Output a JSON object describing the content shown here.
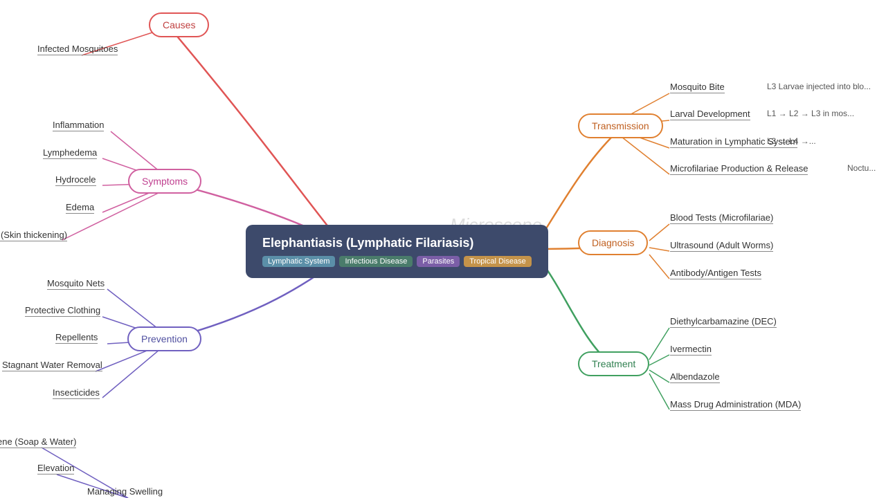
{
  "center": {
    "title": "Elephantiasis (Lymphatic Filariasis)",
    "tags": [
      {
        "label": "Lymphatic System",
        "class": "tag-lymphatic"
      },
      {
        "label": "Infectious Disease",
        "class": "tag-infectious"
      },
      {
        "label": "Parasites",
        "class": "tag-parasites"
      },
      {
        "label": "Tropical Disease",
        "class": "tag-tropical"
      }
    ]
  },
  "branches": {
    "causes": {
      "label": "Causes"
    },
    "symptoms": {
      "label": "Symptoms"
    },
    "prevention": {
      "label": "Prevention"
    },
    "transmission": {
      "label": "Transmission"
    },
    "diagnosis": {
      "label": "Diagnosis"
    },
    "treatment": {
      "label": "Treatment"
    }
  },
  "leaves": {
    "causes": [
      "Infected Mosquitoes"
    ],
    "symptoms": [
      "Inflammation",
      "Lymphedema",
      "Hydrocele",
      "Edema",
      "Elephantiasis (Skin thickening)"
    ],
    "prevention": [
      "Mosquito Nets",
      "Protective Clothing",
      "Repellents",
      "Stagnant Water Removal",
      "Insecticides"
    ],
    "below_prevention": [
      "Hygiene (Soap & Water)",
      "Elevation",
      "Managing Swelling"
    ],
    "transmission": {
      "items": [
        "Mosquito Bite",
        "Larval Development",
        "Maturation in Lymphatic System",
        "Microfilariae Production & Release"
      ],
      "details": [
        "L3 Larvae injected into blo...",
        "L1 → L2 → L3 in mos...",
        "L3 → L4 →...",
        "Noctu..."
      ]
    },
    "diagnosis": [
      "Blood Tests (Microfilariae)",
      "Ultrasound (Adult Worms)",
      "Antibody/Antigen Tests"
    ],
    "treatment": [
      "Diethylcarbamazine (DEC)",
      "Ivermectin",
      "Albendazole",
      "Mass Drug Administration (MDA)"
    ]
  },
  "background": {
    "microscope_text": "Microscope"
  }
}
